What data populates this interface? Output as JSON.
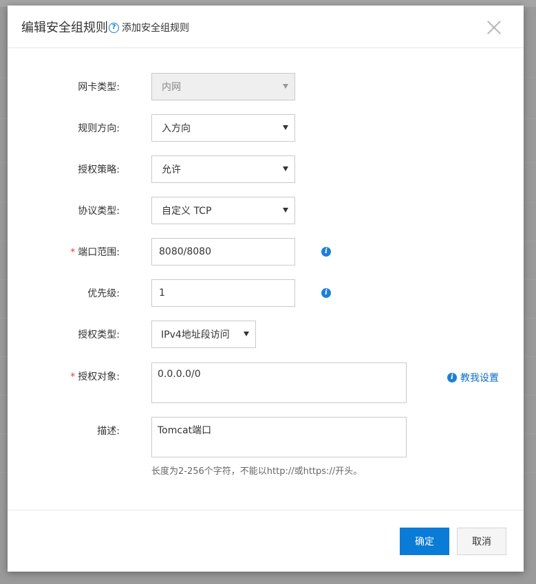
{
  "modal": {
    "title": "编辑安全组规则",
    "help_icon": "?",
    "help_link": "添加安全组规则"
  },
  "form": {
    "nic_type": {
      "label": "网卡类型:",
      "value": "内网"
    },
    "direction": {
      "label": "规则方向:",
      "value": "入方向"
    },
    "policy": {
      "label": "授权策略:",
      "value": "允许"
    },
    "protocol": {
      "label": "协议类型:",
      "value": "自定义 TCP"
    },
    "port_range": {
      "required": "*",
      "label": "端口范围:",
      "value": "8080/8080"
    },
    "priority": {
      "label": "优先级:",
      "value": "1"
    },
    "auth_type": {
      "label": "授权类型:",
      "value": "IPv4地址段访问"
    },
    "auth_object": {
      "required": "*",
      "label": "授权对象:",
      "value": "0.0.0.0/0",
      "help_link": "教我设置"
    },
    "description": {
      "label": "描述:",
      "value": "Tomcat端口",
      "hint": "长度为2-256个字符，不能以http://或https://开头。"
    }
  },
  "icons": {
    "info_glyph": "i",
    "close": "close-icon",
    "dropdown": "chevron-down-icon"
  },
  "footer": {
    "confirm_label": "确定",
    "cancel_label": "取消"
  },
  "colors": {
    "primary": "#0a7bd6",
    "required": "#e0413a",
    "link": "#0a6fc9"
  }
}
